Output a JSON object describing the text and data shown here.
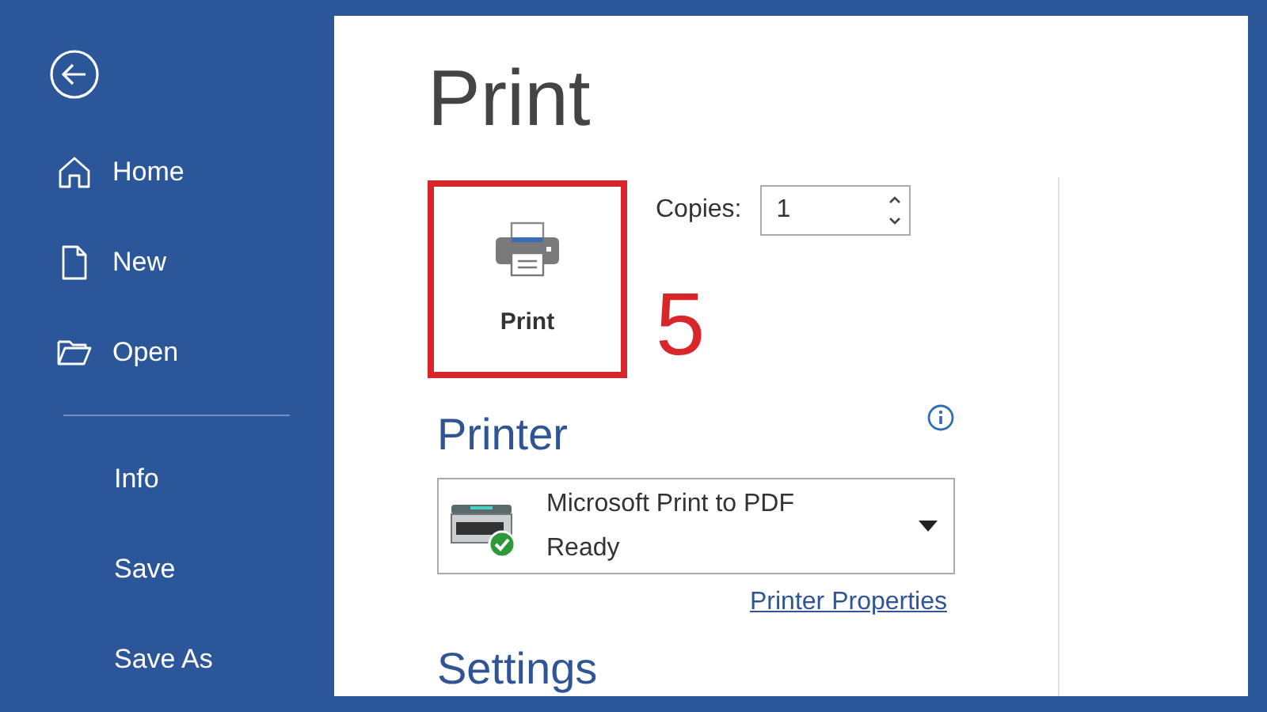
{
  "sidebar": {
    "primary_items": [
      {
        "label": "Home"
      },
      {
        "label": "New"
      },
      {
        "label": "Open"
      }
    ],
    "secondary_items": [
      {
        "label": "Info"
      },
      {
        "label": "Save"
      },
      {
        "label": "Save As"
      }
    ]
  },
  "title": "Print",
  "print_button": {
    "label": "Print",
    "highlighted": true
  },
  "copies": {
    "label": "Copies:",
    "value": "1"
  },
  "annotation": {
    "label": "5"
  },
  "printer": {
    "heading": "Printer",
    "name": "Microsoft Print to PDF",
    "status": "Ready",
    "link": "Printer Properties"
  },
  "settings": {
    "heading": "Settings"
  }
}
